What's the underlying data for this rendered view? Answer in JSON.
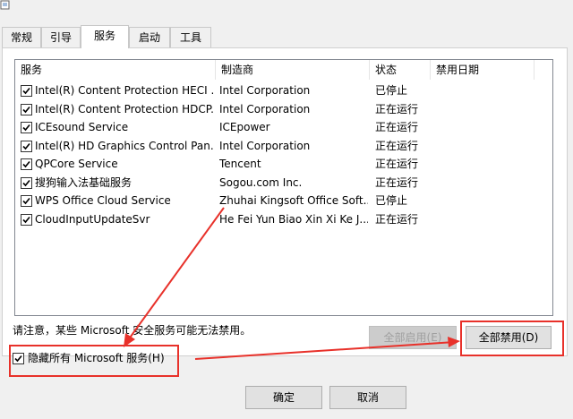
{
  "tabs": [
    "常规",
    "引导",
    "服务",
    "启动",
    "工具"
  ],
  "active_tab": "服务",
  "columns": [
    "服务",
    "制造商",
    "状态",
    "禁用日期"
  ],
  "services": [
    {
      "name": "Intel(R) Content Protection HECI ...",
      "maker": "Intel Corporation",
      "status": "已停止",
      "checked": true
    },
    {
      "name": "Intel(R) Content Protection HDCP...",
      "maker": "Intel Corporation",
      "status": "正在运行",
      "checked": true
    },
    {
      "name": "ICEsound Service",
      "maker": "ICEpower",
      "status": "正在运行",
      "checked": true
    },
    {
      "name": "Intel(R) HD Graphics Control Pan...",
      "maker": "Intel Corporation",
      "status": "正在运行",
      "checked": true
    },
    {
      "name": "QPCore Service",
      "maker": "Tencent",
      "status": "正在运行",
      "checked": true
    },
    {
      "name": "搜狗输入法基础服务",
      "maker": "Sogou.com Inc.",
      "status": "正在运行",
      "checked": true
    },
    {
      "name": "WPS Office Cloud Service",
      "maker": "Zhuhai Kingsoft Office Soft...",
      "status": "已停止",
      "checked": true
    },
    {
      "name": "CloudInputUpdateSvr",
      "maker": "He Fei Yun Biao Xin Xi Ke J...",
      "status": "正在运行",
      "checked": true
    }
  ],
  "note": "请注意，某些 Microsoft 安全服务可能无法禁用。",
  "hide_ms_label": "隐藏所有 Microsoft 服务(H)",
  "hide_ms_checked": true,
  "enable_all_label": "全部启用(E)",
  "disable_all_label": "全部禁用(D)",
  "ok_label": "确定",
  "cancel_label": "取消",
  "colors": {
    "annotation_red": "#e8312a",
    "window_bg": "#f0f0f0"
  }
}
